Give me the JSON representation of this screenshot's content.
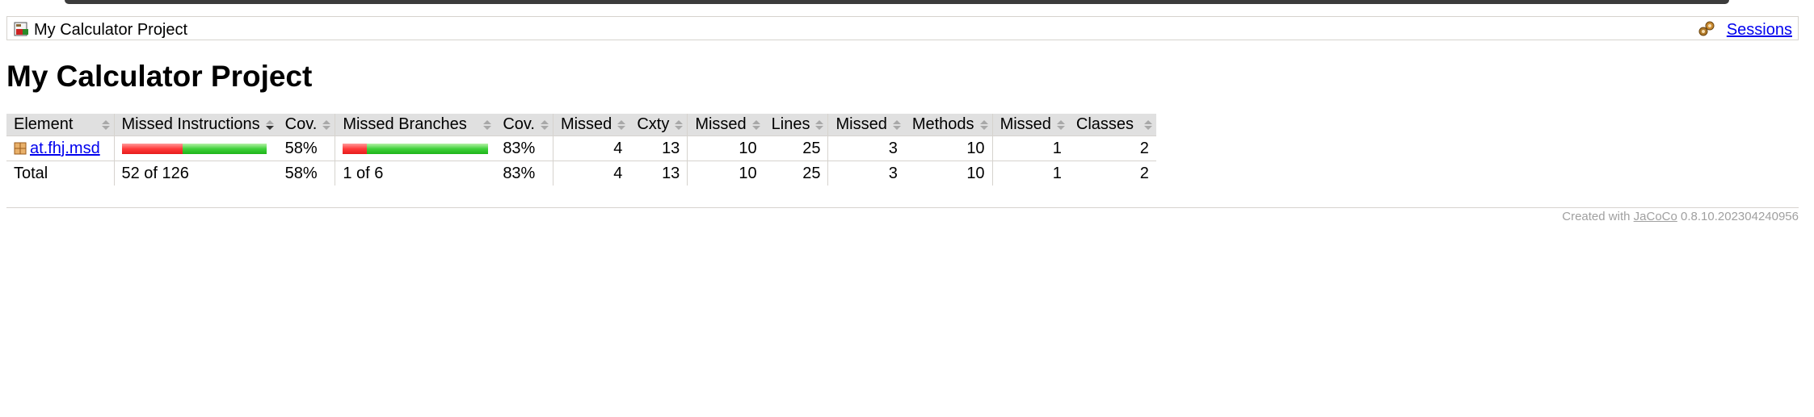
{
  "breadcrumb": {
    "report_icon": "report-icon",
    "title": "My Calculator Project",
    "sessions_icon": "session-icon",
    "sessions_label": "Sessions"
  },
  "page": {
    "heading": "My Calculator Project"
  },
  "table": {
    "columns": [
      "Element",
      "Missed Instructions",
      "Cov.",
      "Missed Branches",
      "Cov.",
      "Missed",
      "Cxty",
      "Missed",
      "Lines",
      "Missed",
      "Methods",
      "Missed",
      "Classes"
    ],
    "sorted_column": "Missed Instructions",
    "sort_direction": "descending",
    "rows": [
      {
        "element": "at.fhj.msd",
        "icon": "package-icon",
        "instructions_coverage": 0.58,
        "instructions_cov": "58%",
        "branches_coverage": 0.83,
        "branches_cov": "83%",
        "missed_cxty": "4",
        "cxty": "13",
        "missed_lines": "10",
        "lines": "25",
        "missed_methods": "3",
        "methods": "10",
        "missed_classes": "1",
        "classes": "2"
      }
    ],
    "total": {
      "label": "Total",
      "missed_instructions": "52 of 126",
      "instructions_cov": "58%",
      "missed_branches": "1 of 6",
      "branches_cov": "83%",
      "missed_cxty": "4",
      "cxty": "13",
      "missed_lines": "10",
      "lines": "25",
      "missed_methods": "3",
      "methods": "10",
      "missed_classes": "1",
      "classes": "2"
    }
  },
  "footer": {
    "prefix": "Created with",
    "link": "JaCoCo",
    "version": "0.8.10.202304240956"
  },
  "colors": {
    "bar_red": "#ff3a3a",
    "bar_green": "#3fd13a",
    "link": "#0000ee",
    "header_bg": "#e0e0e0"
  }
}
